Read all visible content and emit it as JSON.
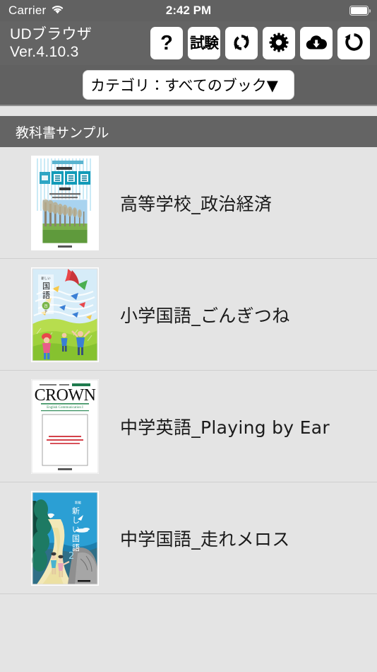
{
  "status_bar": {
    "carrier": "Carrier",
    "wifi_icon": "wifi-icon",
    "time": "2:42 PM",
    "battery_icon": "battery-full-icon"
  },
  "header": {
    "app_name": "UDブラウザ",
    "version": "Ver.4.10.3",
    "toolbar": [
      {
        "name": "help-button",
        "label": "?",
        "icon": "question-mark-icon"
      },
      {
        "name": "exam-button",
        "label": "試験",
        "icon": "exam-text-icon"
      },
      {
        "name": "sync-button",
        "label": "",
        "icon": "sync-arrows-icon"
      },
      {
        "name": "settings-button",
        "label": "",
        "icon": "gear-icon"
      },
      {
        "name": "download-button",
        "label": "",
        "icon": "cloud-download-icon"
      },
      {
        "name": "restore-button",
        "label": "",
        "icon": "restore-circular-arrow-icon"
      }
    ]
  },
  "category": {
    "label": "カテゴリ：すべてのブック▼",
    "selected": "すべてのブック",
    "options": [
      "すべてのブック"
    ]
  },
  "section": {
    "title": "教科書サンプル"
  },
  "books": [
    {
      "title": "高等学校_政治経済",
      "cover": "seiji-keizai-cover"
    },
    {
      "title": "小学国語_ごんぎつね",
      "cover": "atarashii-kokugo-4-cover"
    },
    {
      "title": "中学英語_Playing by Ear",
      "cover": "crown-cover"
    },
    {
      "title": "中学国語_走れメロス",
      "cover": "atarashii-kokugo-2-cover"
    }
  ],
  "colors": {
    "chrome_gray": "#646464",
    "status_gray": "#616161",
    "list_background": "#e4e4e4",
    "divider": "#cfcfcf",
    "button_white": "#ffffff",
    "text_white": "#ffffff",
    "text_dark": "#1a1a1a"
  }
}
